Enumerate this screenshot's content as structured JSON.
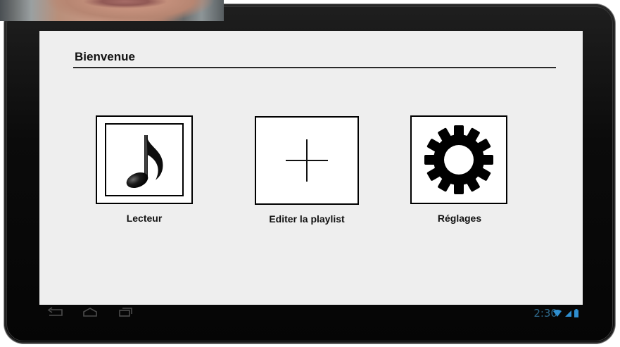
{
  "screen": {
    "title": "Bienvenue",
    "tiles": [
      {
        "label": "Lecteur",
        "icon": "music-note-icon"
      },
      {
        "label": "Editer la playlist",
        "icon": "plus-icon"
      },
      {
        "label": "Réglages",
        "icon": "gear-icon"
      }
    ]
  },
  "navbar": {
    "buttons": [
      "back-icon",
      "home-icon",
      "recent-apps-icon"
    ],
    "clock": "2:30",
    "status_icons": [
      "wifi-icon",
      "signal-icon",
      "battery-icon"
    ],
    "accent_color": "#2f6a8c"
  },
  "colors": {
    "screen_background": "#eeeeee",
    "frame": "#0b0b0b",
    "tile_border": "#000000"
  }
}
